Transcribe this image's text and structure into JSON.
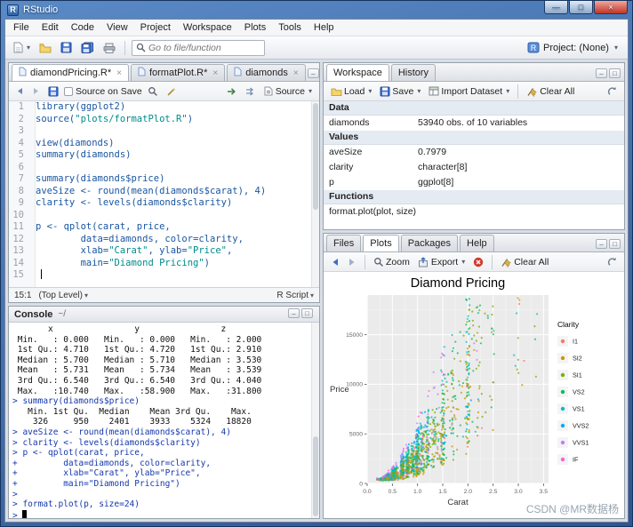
{
  "window": {
    "title": "RStudio",
    "menus": [
      "File",
      "Edit",
      "Code",
      "View",
      "Project",
      "Workspace",
      "Plots",
      "Tools",
      "Help"
    ],
    "goto_placeholder": "Go to file/function",
    "project_label": "Project: (None)"
  },
  "source_pane": {
    "tabs": [
      "diamondPricing.R*",
      "formatPlot.R*",
      "diamonds"
    ],
    "active_tab": 0,
    "toolbar": {
      "source_on_save": "Source on Save",
      "source_menu": "Source"
    },
    "code_lines": [
      "library(ggplot2)",
      "source(\"plots/formatPlot.R\")",
      "",
      "view(diamonds)",
      "summary(diamonds)",
      "",
      "summary(diamonds$price)",
      "aveSize <- round(mean(diamonds$carat), 4)",
      "clarity <- levels(diamonds$clarity)",
      "",
      "p <- qplot(carat, price,",
      "        data=diamonds, color=clarity,",
      "        xlab=\"Carat\", ylab=\"Price\",",
      "        main=\"Diamond Pricing\")",
      ""
    ],
    "status": {
      "position": "15:1",
      "scope": "(Top Level)",
      "doc_type": "R Script"
    }
  },
  "console_pane": {
    "title": "Console",
    "path": "~/",
    "lines": [
      "       x                y                z        ",
      " Min.   : 0.000   Min.   : 0.000   Min.   : 2.000 ",
      " 1st Qu.: 4.710   1st Qu.: 4.720   1st Qu.: 2.910 ",
      " Median : 5.700   Median : 5.710   Median : 3.530 ",
      " Mean   : 5.731   Mean   : 5.734   Mean   : 3.539 ",
      " 3rd Qu.: 6.540   3rd Qu.: 6.540   3rd Qu.: 4.040 ",
      " Max.   :10.740   Max.   :58.900   Max.   :31.800 ",
      "> summary(diamonds$price)",
      "   Min. 1st Qu.  Median    Mean 3rd Qu.    Max. ",
      "    326     950    2401    3933    5324   18820 ",
      "> aveSize <- round(mean(diamonds$carat), 4)",
      "> clarity <- levels(diamonds$clarity)",
      "> p <- qplot(carat, price,",
      "+         data=diamonds, color=clarity,",
      "+         xlab=\"Carat\", ylab=\"Price\",",
      "+         main=\"Diamond Pricing\")",
      "> ",
      "> format.plot(p, size=24)",
      "> "
    ]
  },
  "workspace_pane": {
    "tabs": [
      "Workspace",
      "History"
    ],
    "active_tab": 0,
    "toolbar": {
      "load": "Load",
      "save": "Save",
      "import": "Import Dataset",
      "clear": "Clear All"
    },
    "sections": [
      {
        "header": "Data",
        "rows": [
          {
            "name": "diamonds",
            "value": "53940 obs. of 10 variables"
          }
        ]
      },
      {
        "header": "Values",
        "rows": [
          {
            "name": "aveSize",
            "value": "0.7979"
          },
          {
            "name": "clarity",
            "value": "character[8]"
          },
          {
            "name": "p",
            "value": "ggplot[8]"
          }
        ]
      },
      {
        "header": "Functions",
        "rows": [
          {
            "name": "format.plot(plot, size)",
            "value": ""
          }
        ]
      }
    ]
  },
  "plots_pane": {
    "tabs": [
      "Files",
      "Plots",
      "Packages",
      "Help"
    ],
    "active_tab": 1,
    "toolbar": {
      "zoom": "Zoom",
      "export": "Export",
      "clear": "Clear All"
    },
    "watermark": "CSDN @MR数据杨",
    "chart_data": {
      "type": "scatter",
      "title": "Diamond Pricing",
      "xlabel": "Carat",
      "ylabel": "Price",
      "xlim": [
        0.0,
        3.6
      ],
      "ylim": [
        0,
        19000
      ],
      "xticks": [
        0.0,
        0.5,
        1.0,
        1.5,
        2.0,
        2.5,
        3.0,
        3.5
      ],
      "yticks": [
        0,
        5000,
        10000,
        15000
      ],
      "grid": true,
      "panel_bg": "#ebebeb",
      "legend_title": "Clarity",
      "legend_position": "right",
      "series": [
        {
          "name": "I1",
          "color": "#F8766D",
          "weight": 1.5
        },
        {
          "name": "SI2",
          "color": "#CD9600",
          "weight": 9
        },
        {
          "name": "SI1",
          "color": "#7CAE00",
          "weight": 13
        },
        {
          "name": "VS2",
          "color": "#00BE67",
          "weight": 12
        },
        {
          "name": "VS1",
          "color": "#00BFC4",
          "weight": 8
        },
        {
          "name": "VVS2",
          "color": "#00A9FF",
          "weight": 5
        },
        {
          "name": "VVS1",
          "color": "#C77CFF",
          "weight": 4
        },
        {
          "name": "IF",
          "color": "#FF61CC",
          "weight": 2
        }
      ],
      "n_points": 1600,
      "x_range_data": [
        0.2,
        3.5
      ],
      "y_range_data": [
        326,
        18820
      ],
      "trend": "price increases ~carat^1.95 with widening spread; dense clusters at common carat sizes (0.3, 0.5, 0.7, 1.0, 1.5, 2.0)"
    }
  }
}
